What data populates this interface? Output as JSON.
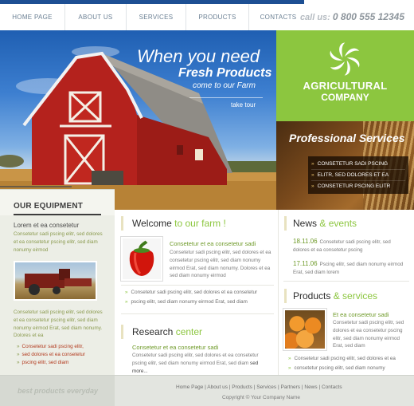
{
  "header": {
    "nav": [
      "HOME PAGE",
      "ABOUT US",
      "SERVICES",
      "PRODUCTS",
      "CONTACTS"
    ],
    "callus_label": "call us:",
    "phone": "0 800 555 12345"
  },
  "hero": {
    "line1": "When you need",
    "line2": "Fresh Products",
    "line3": "come to our Farm",
    "tour": "take tour"
  },
  "brand": {
    "line1": "AGRICULTURAL",
    "line2": "COMPANY"
  },
  "services": {
    "title": "Professional Services",
    "items": [
      "CONSETETUR SADI PSCING",
      "ELITR, SED DOLORES ET EA",
      "CONSETETUR PSCING ELITR"
    ]
  },
  "sidebar": {
    "title": "OUR EQUIPMENT",
    "lead": "Lorem et ea consetetur",
    "para1": "Consetetur sadi pscing elitr, sed dolores et ea consetetur pscing elitr, sed diam nonumy eirmod",
    "para2": "Consetetur sadi pscing elitr, sed dolores et ea consetetur pscing elitr, sed diam nonumy eirmod Erat, sed diam nonumy. Dolores et ea",
    "links": [
      "Consetetur sadi pscing elitr,",
      "sed dolores et ea consetetur",
      "pscing elitr, sed diam"
    ]
  },
  "welcome": {
    "title_a": "Welcome",
    "title_b": " to our farm !",
    "head": "Consetetur et ea consetetur sadi",
    "body": "Consetetur sadi pscing elitr, sed dolores et ea consetetur pscing elitr, sed diam nonumy eirmod Erat, sed diam nonumy. Dolores et ea sed diam nonumy eirmod",
    "list": [
      "Consetetur sadi pscing elitr, sed dolores et ea consetetur",
      "pscing elitr, sed diam nonumy eirmod Erat, sed diam"
    ]
  },
  "research": {
    "title_a": "Research",
    "title_b": " center",
    "head": "Consetetur et ea consetetur sadi",
    "body": "Consetetur sadi pscing elitr, sed dolores et ea consetetur pscing elitr, sed diam nonumy eirmod Erat, sed diam",
    "more": "sed more..."
  },
  "news": {
    "title_a": "News",
    "title_b": " & events",
    "items": [
      {
        "date": "18.11.06",
        "text": "Consetetur sadi pscing elitr, sed dolores et ea consetetur pscing"
      },
      {
        "date": "17.11.06",
        "text": "Pscing elitr, sed diam nonumy eirmod Erat, sed diam lorem"
      }
    ]
  },
  "products": {
    "title_a": "Products",
    "title_b": " & services",
    "head": "Et ea consetetur sadi",
    "body": "Consetetur sadi pscing elitr, sed dolores et ea consetetur pscing elitr, sed diam nonumy eirmod Erat, sed diam",
    "list": [
      "Consetetur sadi pscing elitr, sed dolores et ea",
      "consetetur pscing elitr, sed diam nonumy"
    ]
  },
  "footer": {
    "slogan": "best products everyday",
    "links": [
      "Home Page",
      "About us",
      "Products",
      "Services",
      "Partners",
      "News",
      "Contacts"
    ],
    "copyright": "Copyright © Your Company Name"
  },
  "colors": {
    "accent_green": "#8cc63f",
    "nav_blue": "#1d4f93",
    "barn_red": "#b4221d"
  }
}
